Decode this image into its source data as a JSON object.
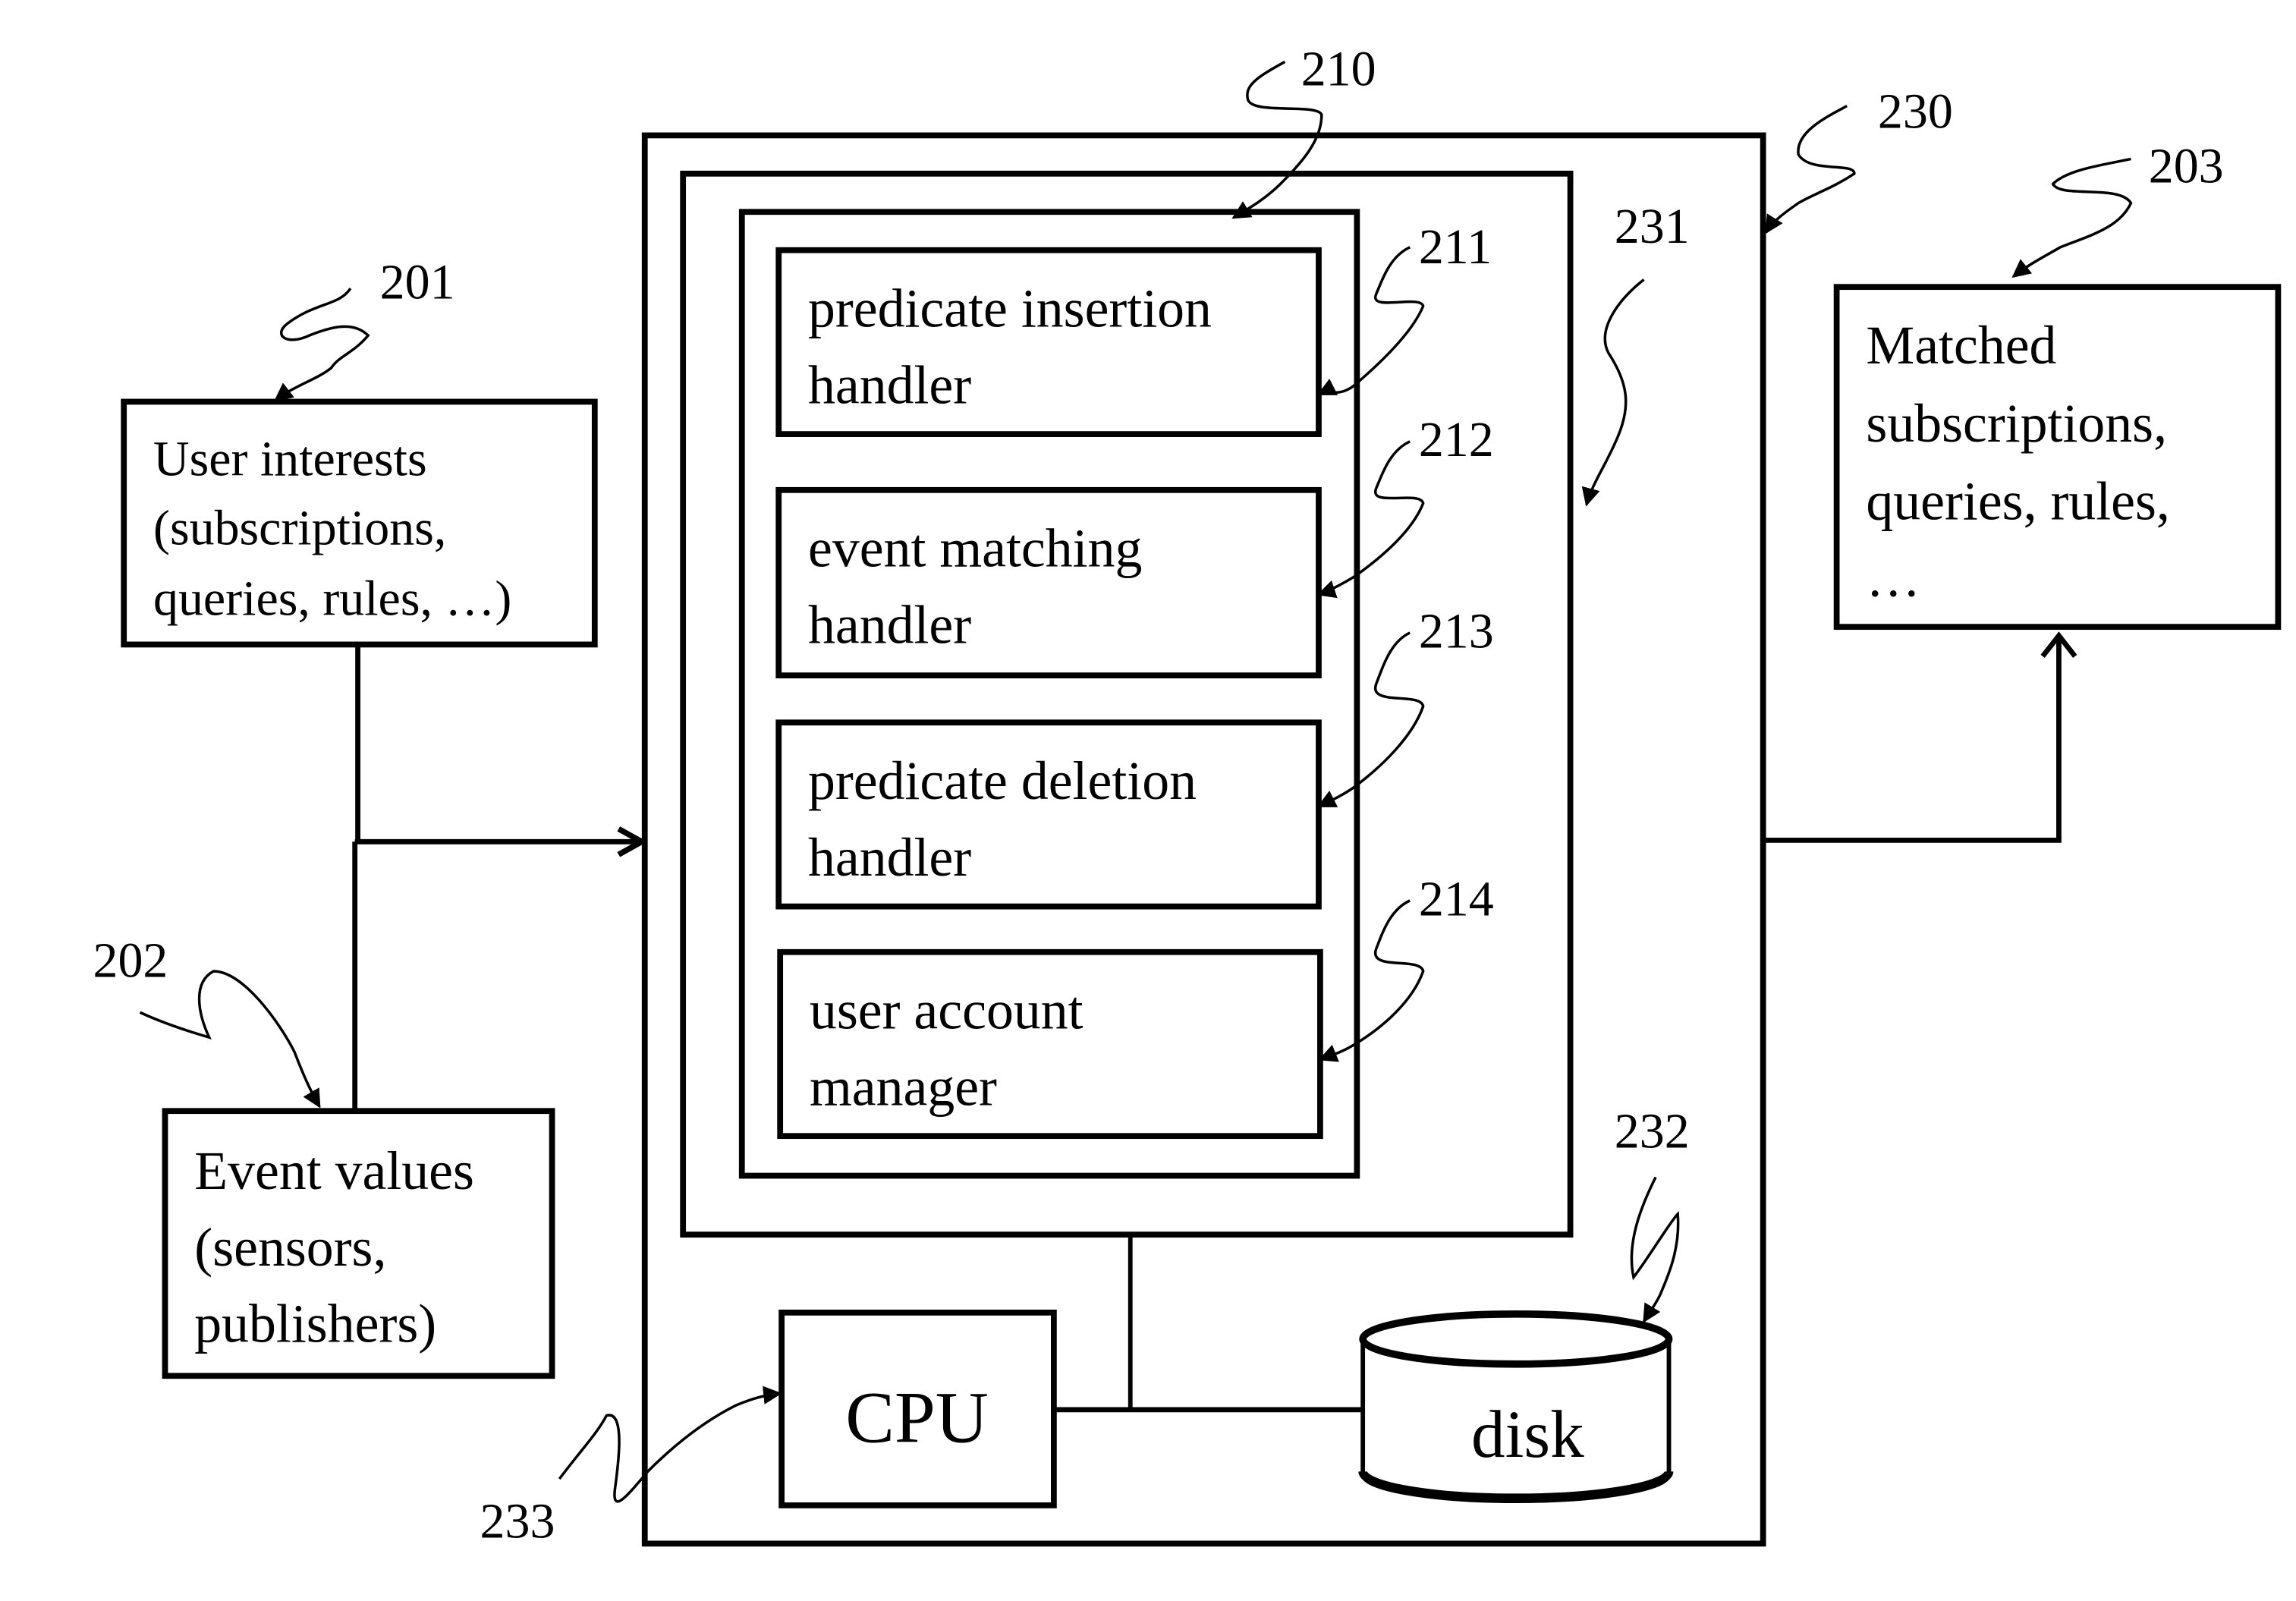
{
  "diagram": {
    "user_interests": {
      "ref": "201",
      "lines": [
        "User interests",
        "(subscriptions,",
        "queries, rules, …)"
      ]
    },
    "event_values": {
      "ref": "202",
      "lines": [
        "Event values",
        "(sensors,",
        "publishers)"
      ]
    },
    "matched": {
      "ref": "203",
      "lines": [
        "Matched",
        "subscriptions,",
        "queries, rules,",
        "…"
      ]
    },
    "server": {
      "ref": "230"
    },
    "memory": {
      "ref": "231"
    },
    "software": {
      "ref": "210"
    },
    "handlers": [
      {
        "ref": "211",
        "lines": [
          "predicate insertion",
          "handler"
        ]
      },
      {
        "ref": "212",
        "lines": [
          "event matching",
          "handler"
        ]
      },
      {
        "ref": "213",
        "lines": [
          "predicate deletion",
          "handler"
        ]
      },
      {
        "ref": "214",
        "lines": [
          "user account",
          "manager"
        ]
      }
    ],
    "disk": {
      "ref": "232",
      "label": "disk"
    },
    "cpu": {
      "ref": "233",
      "label": "CPU"
    }
  }
}
